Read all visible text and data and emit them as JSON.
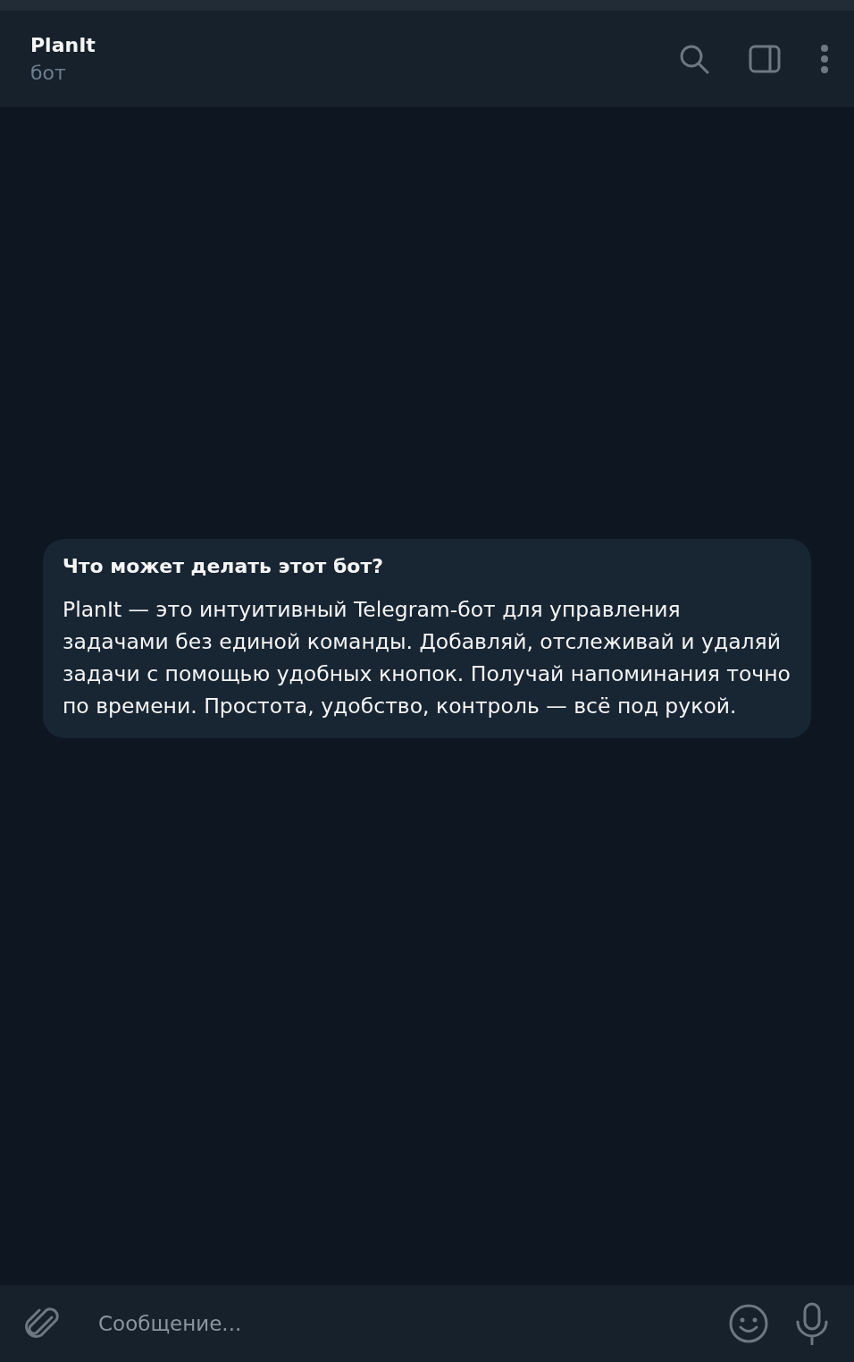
{
  "header": {
    "title": "PlanIt",
    "subtitle": "бот"
  },
  "intro": {
    "title": "Что может делать этот бот?",
    "text": "PlanIt — это интуитивный Telegram-бот для управления задачами без единой команды. Добавляй, отслеживай и удаляй задачи с помощью удобных кнопок. Получай напоминания точно по времени. Простота, удобство, контроль — всё под рукой."
  },
  "composer": {
    "placeholder": "Сообщение..."
  }
}
